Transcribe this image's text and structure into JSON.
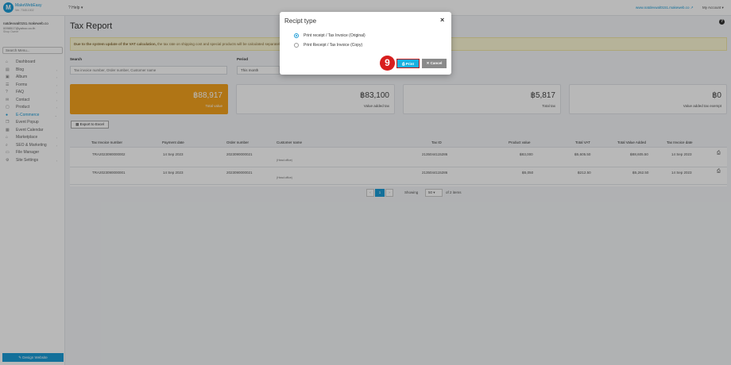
{
  "topbar": {
    "brand_name": "MakeWebEasy",
    "brand_sub": "Ver. 7345.1002",
    "help_label": "Help",
    "site_url": "www.natdevwal0151.makeweb.co",
    "account_label": "My Account"
  },
  "sidebar": {
    "user_site": "natdevwal0151.makeweb.co",
    "user_email": "0098517@yahoo.co.th",
    "user_role": "Shop Owner",
    "search_placeholder": "Search Menu...",
    "items": [
      {
        "label": "Dashboard",
        "icon": "home-icon"
      },
      {
        "label": "Blog",
        "icon": "blog-icon"
      },
      {
        "label": "Album",
        "icon": "album-icon"
      },
      {
        "label": "Forms",
        "icon": "forms-icon"
      },
      {
        "label": "FAQ",
        "icon": "faq-icon"
      },
      {
        "label": "Contact",
        "icon": "contact-icon"
      },
      {
        "label": "Product",
        "icon": "product-icon"
      },
      {
        "label": "E-Commerce",
        "icon": "cart-icon"
      },
      {
        "label": "Event Popup",
        "icon": "popup-icon"
      },
      {
        "label": "Event Calendar",
        "icon": "calendar-icon"
      },
      {
        "label": "Marketplace",
        "icon": "marketplace-icon"
      },
      {
        "label": "SEO & Marketing",
        "icon": "seo-icon"
      },
      {
        "label": "File Manager",
        "icon": "folder-icon"
      },
      {
        "label": "Site Settings",
        "icon": "gear-icon"
      }
    ],
    "design_button": "Design Website"
  },
  "main": {
    "title": "Tax Report",
    "notice_bold": "Due to the system update of the VAT calculation,",
    "notice_text": " the tax rate on shipping cost and special products will be calculated separately",
    "search_label": "Search",
    "search_placeholder": "Tax invoice number, Order number, Customer name",
    "period_label": "Period",
    "period_value": "This month",
    "cards": [
      {
        "value": "฿88,917",
        "label": "Total value"
      },
      {
        "value": "฿83,100",
        "label": "Value added tax"
      },
      {
        "value": "฿5,817",
        "label": "Total tax"
      },
      {
        "value": "฿0",
        "label": "Value added tax exempt"
      }
    ],
    "export_label": "Export to Excel",
    "table": {
      "headers": [
        "Tax Invoice number",
        "Payment date",
        "Order number",
        "Customer name",
        "Tax ID",
        "Product value",
        "Total VAT",
        "Total Value Added",
        "Tax Invoice date"
      ],
      "rows": [
        {
          "invoice": "TRA2023090000002",
          "payment_date": "14 Sep 2023",
          "order": "2023090000021",
          "customer": "(Head office)",
          "tax_id": "2135044115286",
          "product_value": "฿83,000",
          "total_vat": "฿5,605.50",
          "total_added": "฿88,605.50",
          "invoice_date": "14 Sep 2023"
        },
        {
          "invoice": "TRA2023090000001",
          "payment_date": "14 Sep 2023",
          "order": "2023090000021",
          "customer": "(Head office)",
          "tax_id": "2135044115286",
          "product_value": "฿5,050",
          "total_vat": "฿212.50",
          "total_added": "฿5,262.50",
          "invoice_date": "14 Sep 2023"
        }
      ]
    },
    "pager": {
      "prev": "‹",
      "current": "1",
      "next": "›",
      "showing_label": "Showing",
      "per_page": "50",
      "of_items": "of 2 items"
    }
  },
  "modal": {
    "title": "Recipt type",
    "close": "×",
    "options": [
      {
        "label": "Print receipt / Tax Invoice (Original)",
        "selected": true
      },
      {
        "label": "Print Receipt / Tax Invoice (Copy)",
        "selected": false
      }
    ],
    "step_number": "9",
    "print_label": "Print",
    "cancel_label": "Cancel"
  },
  "colors": {
    "accent": "#1b9bd6",
    "card_highlight": "#f4a21e",
    "step_badge": "#d81e1e"
  }
}
